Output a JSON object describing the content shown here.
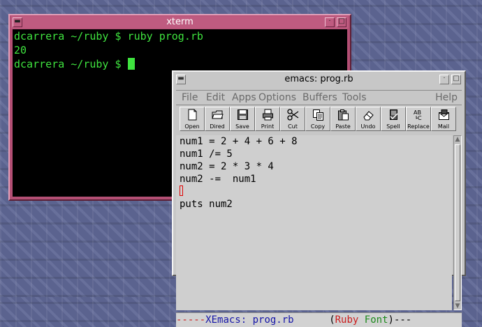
{
  "xterm": {
    "title": "xterm",
    "lines": [
      "dcarrera ~/ruby $ ruby prog.rb",
      "20",
      "dcarrera ~/ruby $ "
    ]
  },
  "emacs": {
    "title": "emacs: prog.rb",
    "menu": [
      "File",
      "Edit",
      "Apps",
      "Options",
      "Buffers",
      "Tools",
      "Help"
    ],
    "toolbar": [
      {
        "label": "Open",
        "icon": "open-folder-icon"
      },
      {
        "label": "Dired",
        "icon": "dired-icon"
      },
      {
        "label": "Save",
        "icon": "floppy-disk-icon"
      },
      {
        "label": "Print",
        "icon": "printer-icon"
      },
      {
        "label": "Cut",
        "icon": "scissors-icon"
      },
      {
        "label": "Copy",
        "icon": "copy-icon"
      },
      {
        "label": "Paste",
        "icon": "clipboard-icon"
      },
      {
        "label": "Undo",
        "icon": "eraser-icon"
      },
      {
        "label": "Spell",
        "icon": "spellcheck-icon"
      },
      {
        "label": "Replace",
        "icon": "replace-icon"
      },
      {
        "label": "Mail",
        "icon": "mail-icon"
      }
    ],
    "code": [
      "num1 = 2 + 4 + 6 + 8",
      "num1 /= 5",
      "num2 = 2 * 3 * 4",
      "num2 -=  num1",
      "",
      "puts num2"
    ],
    "modeline": {
      "dashes_left": "-----",
      "app": "XEmacs: ",
      "buffer": "prog.rb",
      "open_paren": "(",
      "mode": "Ruby",
      "minor": "Font",
      "close_paren": ")",
      "dashes_right": "---"
    }
  }
}
